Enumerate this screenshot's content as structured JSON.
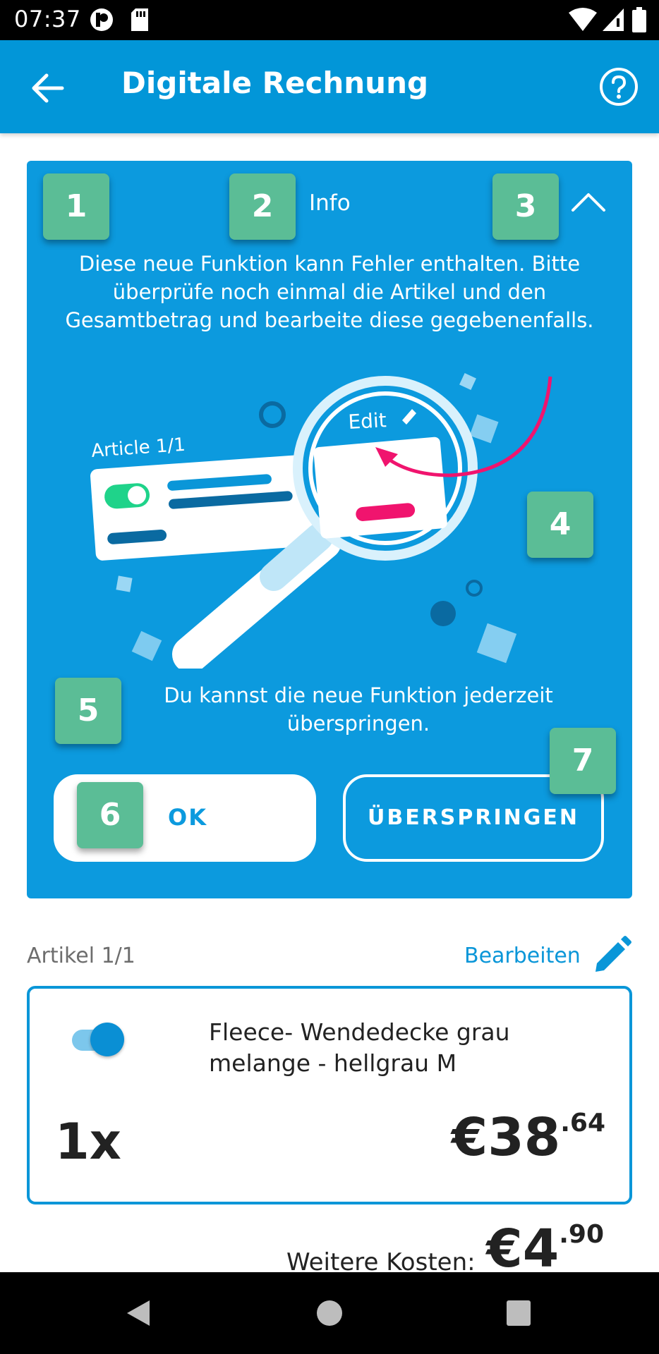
{
  "status_bar": {
    "time": "07:37",
    "icons": [
      "notification-icon",
      "sd-card-icon",
      "wifi-icon",
      "signal-icon",
      "battery-icon"
    ]
  },
  "app_bar": {
    "title": "Digitale Rechnung",
    "back_icon": "arrow-left-icon",
    "help_icon": "help-circle-icon",
    "color": "#0296d8"
  },
  "info_card": {
    "header_label": "Info",
    "collapse_icon": "chevron-up-icon",
    "message": "Diese neue Funktion kann Fehler enthalten. Bitte überprüfe noch einmal die Artikel und den Gesamtbetrag und bearbeite diese gegebenenfalls.",
    "illustration": {
      "article_label": "Article 1/1",
      "edit_label": "Edit"
    },
    "skip_hint": "Du kannst die neue Funktion jederzeit überspringen.",
    "ok_label": "OK",
    "skip_label": "ÜBERSPRINGEN",
    "color": "#0c9ade"
  },
  "badges": [
    "1",
    "2",
    "3",
    "4",
    "5",
    "6",
    "7"
  ],
  "articles": {
    "count_label": "Artikel 1/1",
    "edit_label": "Bearbeiten",
    "edit_icon": "pencil-icon",
    "items": [
      {
        "name": "Fleece- Wendedecke grau melange - hellgrau M",
        "enabled": true,
        "quantity": "1x",
        "price_main": "€38",
        "price_cents": ".64"
      }
    ]
  },
  "further_costs": {
    "label": "Weitere Kosten:",
    "value_main": "€4",
    "value_cents": ".90"
  },
  "nav_bar": {
    "icons": [
      "back-triangle-icon",
      "home-circle-icon",
      "recents-square-icon"
    ]
  }
}
